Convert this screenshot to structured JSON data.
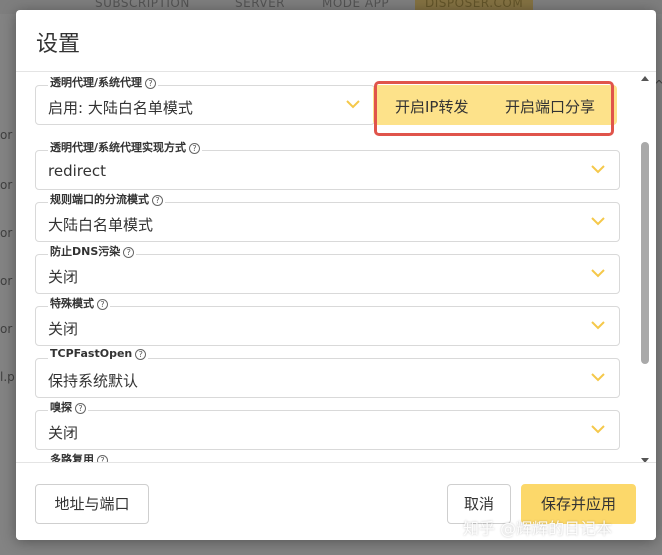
{
  "background": {
    "tabs": [
      "SUBSCRIPTION",
      "SERVER",
      "MODE APP",
      "DISPOSER.COM"
    ]
  },
  "dialog": {
    "title": "设置",
    "fields": [
      {
        "label": "透明代理/系统代理",
        "value": "启用: 大陆白名单模式",
        "has_help": true
      },
      {
        "label": "透明代理/系统代理实现方式",
        "value": "redirect",
        "has_help": true
      },
      {
        "label": "规则端口的分流模式",
        "value": "大陆白名单模式",
        "has_help": true
      },
      {
        "label": "防止DNS污染",
        "value": "关闭",
        "has_help": true
      },
      {
        "label": "特殊模式",
        "value": "关闭",
        "has_help": true
      },
      {
        "label": "TCPFastOpen",
        "value": "保持系统默认",
        "has_help": true
      },
      {
        "label": "嗅探",
        "value": "关闭",
        "has_help": true
      },
      {
        "label": "多路复用",
        "value": "",
        "has_help": true
      }
    ],
    "toggles": {
      "ip_forward": "开启IP转发",
      "port_share": "开启端口分享"
    },
    "footer": {
      "address_port": "地址与端口",
      "cancel": "取消",
      "save_apply": "保存并应用"
    }
  },
  "watermark": "知乎 @辉辉的日记本",
  "colors": {
    "accent": "#fcd86a",
    "highlight": "#e0544b",
    "chevron": "#f5c84a"
  }
}
